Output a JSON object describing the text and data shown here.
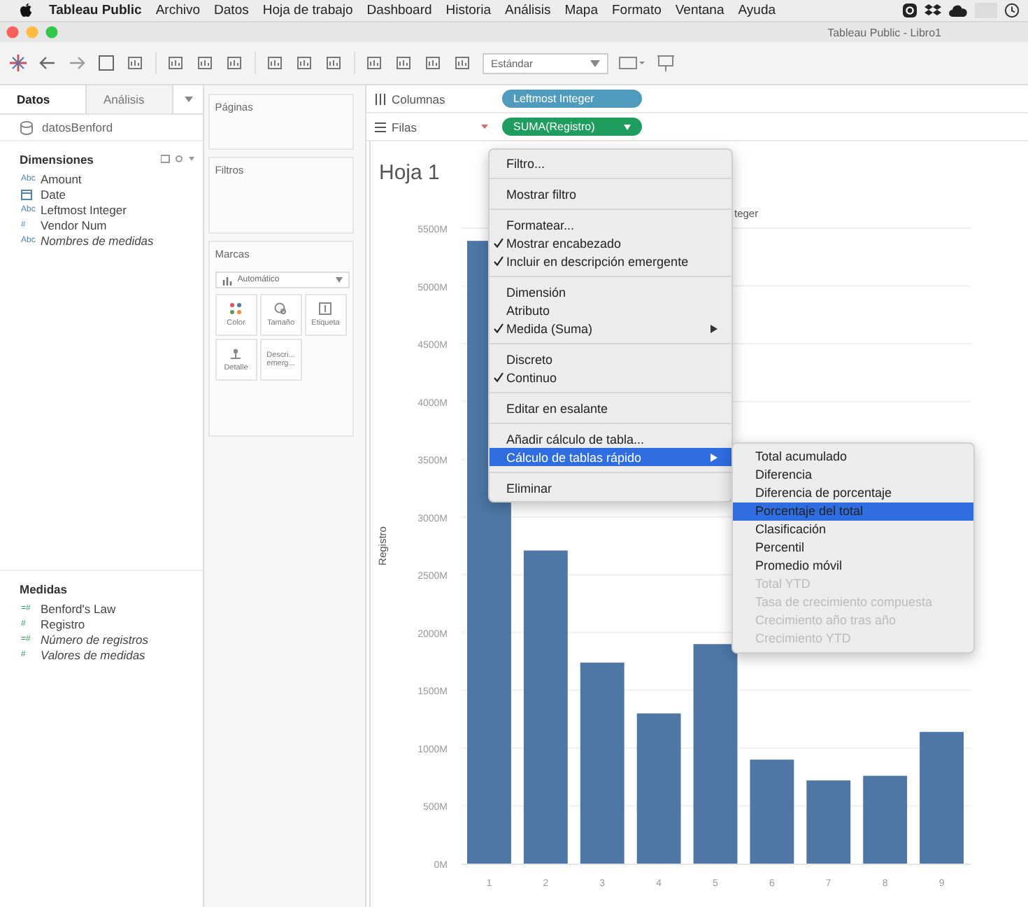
{
  "menubar": {
    "app": "Tableau Public",
    "items": [
      "Archivo",
      "Datos",
      "Hoja de trabajo",
      "Dashboard",
      "Historia",
      "Análisis",
      "Mapa",
      "Formato",
      "Ventana",
      "Ayuda"
    ]
  },
  "window": {
    "title": "Tableau Public - Libro1"
  },
  "toolbar": {
    "dropdown": "Estándar"
  },
  "data_pane": {
    "tabs": [
      {
        "label": "Datos",
        "selected": true
      },
      {
        "label": "Análisis",
        "selected": false
      }
    ],
    "source": "datosBenford",
    "dimensions": {
      "title": "Dimensiones",
      "fields": [
        {
          "name": "Amount",
          "kind": "badge",
          "badge": "Abc",
          "italic": false
        },
        {
          "name": "Date",
          "kind": "date",
          "italic": false
        },
        {
          "name": "Leftmost Integer",
          "kind": "badge",
          "badge": "Abc",
          "italic": false
        },
        {
          "name": "Vendor Num",
          "kind": "badge",
          "badge": "#",
          "italic": false
        },
        {
          "name": "Nombres de medidas",
          "kind": "badge",
          "badge": "Abc",
          "italic": true
        }
      ]
    },
    "measures": {
      "title": "Medidas",
      "fields": [
        {
          "name": "Benford's Law",
          "kind": "badge",
          "badge": "=#",
          "italic": false
        },
        {
          "name": "Registro",
          "kind": "badge",
          "badge": "#",
          "italic": false
        },
        {
          "name": "Número de registros",
          "kind": "badge",
          "badge": "=#",
          "italic": true
        },
        {
          "name": "Valores de medidas",
          "kind": "badge",
          "badge": "#",
          "italic": true
        }
      ]
    }
  },
  "cards": {
    "pages": "Páginas",
    "filters": "Filtros",
    "marks": {
      "title": "Marcas",
      "type": "Automático",
      "buttons": [
        {
          "label": "Color",
          "kind": "color"
        },
        {
          "label": "Tamaño",
          "kind": "size"
        },
        {
          "label": "Etiqueta",
          "kind": "label"
        },
        {
          "label": "Detalle",
          "kind": "detail"
        },
        {
          "label": "Descri... emerg...",
          "kind": "tooltip"
        }
      ]
    }
  },
  "shelves": [
    {
      "label": "Columnas",
      "kind": "columns",
      "pills": [
        {
          "text": "Leftmost Integer",
          "color": "#4f9bbd"
        }
      ]
    },
    {
      "label": "Filas",
      "kind": "rows",
      "pills": [
        {
          "text": "SUMA(Registro)",
          "color": "#1f9d5e"
        }
      ]
    }
  ],
  "sheet": {
    "title": "Hoja 1",
    "chart_data": {
      "type": "bar",
      "xlabel": "teger",
      "ylabel": "Registro",
      "categories": [
        "1",
        "2",
        "3",
        "4",
        "5",
        "6",
        "7",
        "8",
        "9"
      ],
      "grid": true,
      "series": [
        {
          "color": "#4e77a6",
          "values": [
            5390,
            2710,
            1740,
            1300,
            1900,
            900,
            720,
            760,
            1140
          ]
        }
      ],
      "ylim": [
        0,
        5500
      ],
      "yticks": [
        {
          "value": 0,
          "label": "0M"
        },
        {
          "value": 500,
          "label": "500M"
        },
        {
          "value": 1000,
          "label": "1000M"
        },
        {
          "value": 1500,
          "label": "1500M"
        },
        {
          "value": 2000,
          "label": "2000M"
        },
        {
          "value": 2500,
          "label": "2500M"
        },
        {
          "value": 3000,
          "label": "3000M"
        },
        {
          "value": 3500,
          "label": "3500M"
        },
        {
          "value": 4000,
          "label": "4000M"
        },
        {
          "value": 4500,
          "label": "4500M"
        },
        {
          "value": 5000,
          "label": "5000M"
        },
        {
          "value": 5500,
          "label": "5500M"
        }
      ]
    }
  },
  "context_menu": {
    "groups": [
      [
        {
          "label": "Filtro...",
          "checked": false,
          "selected": false,
          "submenu": false
        }
      ],
      [
        {
          "label": "Mostrar filtro",
          "checked": false,
          "selected": false,
          "submenu": false
        }
      ],
      [
        {
          "label": "Formatear...",
          "checked": false,
          "selected": false,
          "submenu": false
        },
        {
          "label": "Mostrar encabezado",
          "checked": true,
          "selected": false,
          "submenu": false
        },
        {
          "label": "Incluir en descripción emergente",
          "checked": true,
          "selected": false,
          "submenu": false
        }
      ],
      [
        {
          "label": "Dimensión",
          "checked": false,
          "selected": false,
          "submenu": false
        },
        {
          "label": "Atributo",
          "checked": false,
          "selected": false,
          "submenu": false
        },
        {
          "label": "Medida (Suma)",
          "checked": true,
          "selected": false,
          "submenu": true
        }
      ],
      [
        {
          "label": "Discreto",
          "checked": false,
          "selected": false,
          "submenu": false
        },
        {
          "label": "Continuo",
          "checked": true,
          "selected": false,
          "submenu": false
        }
      ],
      [
        {
          "label": "Editar en esalante",
          "checked": false,
          "selected": false,
          "submenu": false
        }
      ],
      [
        {
          "label": "Añadir cálculo de tabla...",
          "checked": false,
          "selected": false,
          "submenu": false
        },
        {
          "label": "Cálculo de tablas rápido",
          "checked": false,
          "selected": true,
          "submenu": true
        }
      ],
      [
        {
          "label": "Eliminar",
          "checked": false,
          "selected": false,
          "submenu": false
        }
      ]
    ]
  },
  "submenu": {
    "items": [
      {
        "label": "Total acumulado",
        "selected": false,
        "disabled": false
      },
      {
        "label": "Diferencia",
        "selected": false,
        "disabled": false
      },
      {
        "label": "Diferencia de porcentaje",
        "selected": false,
        "disabled": false
      },
      {
        "label": "Porcentaje del total",
        "selected": true,
        "disabled": false
      },
      {
        "label": "Clasificación",
        "selected": false,
        "disabled": false
      },
      {
        "label": "Percentil",
        "selected": false,
        "disabled": false
      },
      {
        "label": "Promedio móvil",
        "selected": false,
        "disabled": false
      },
      {
        "label": "Total YTD",
        "selected": false,
        "disabled": true
      },
      {
        "label": "Tasa de crecimiento compuesta",
        "selected": false,
        "disabled": true
      },
      {
        "label": "Crecimiento año tras año",
        "selected": false,
        "disabled": true
      },
      {
        "label": "Crecimiento YTD",
        "selected": false,
        "disabled": true
      }
    ]
  }
}
